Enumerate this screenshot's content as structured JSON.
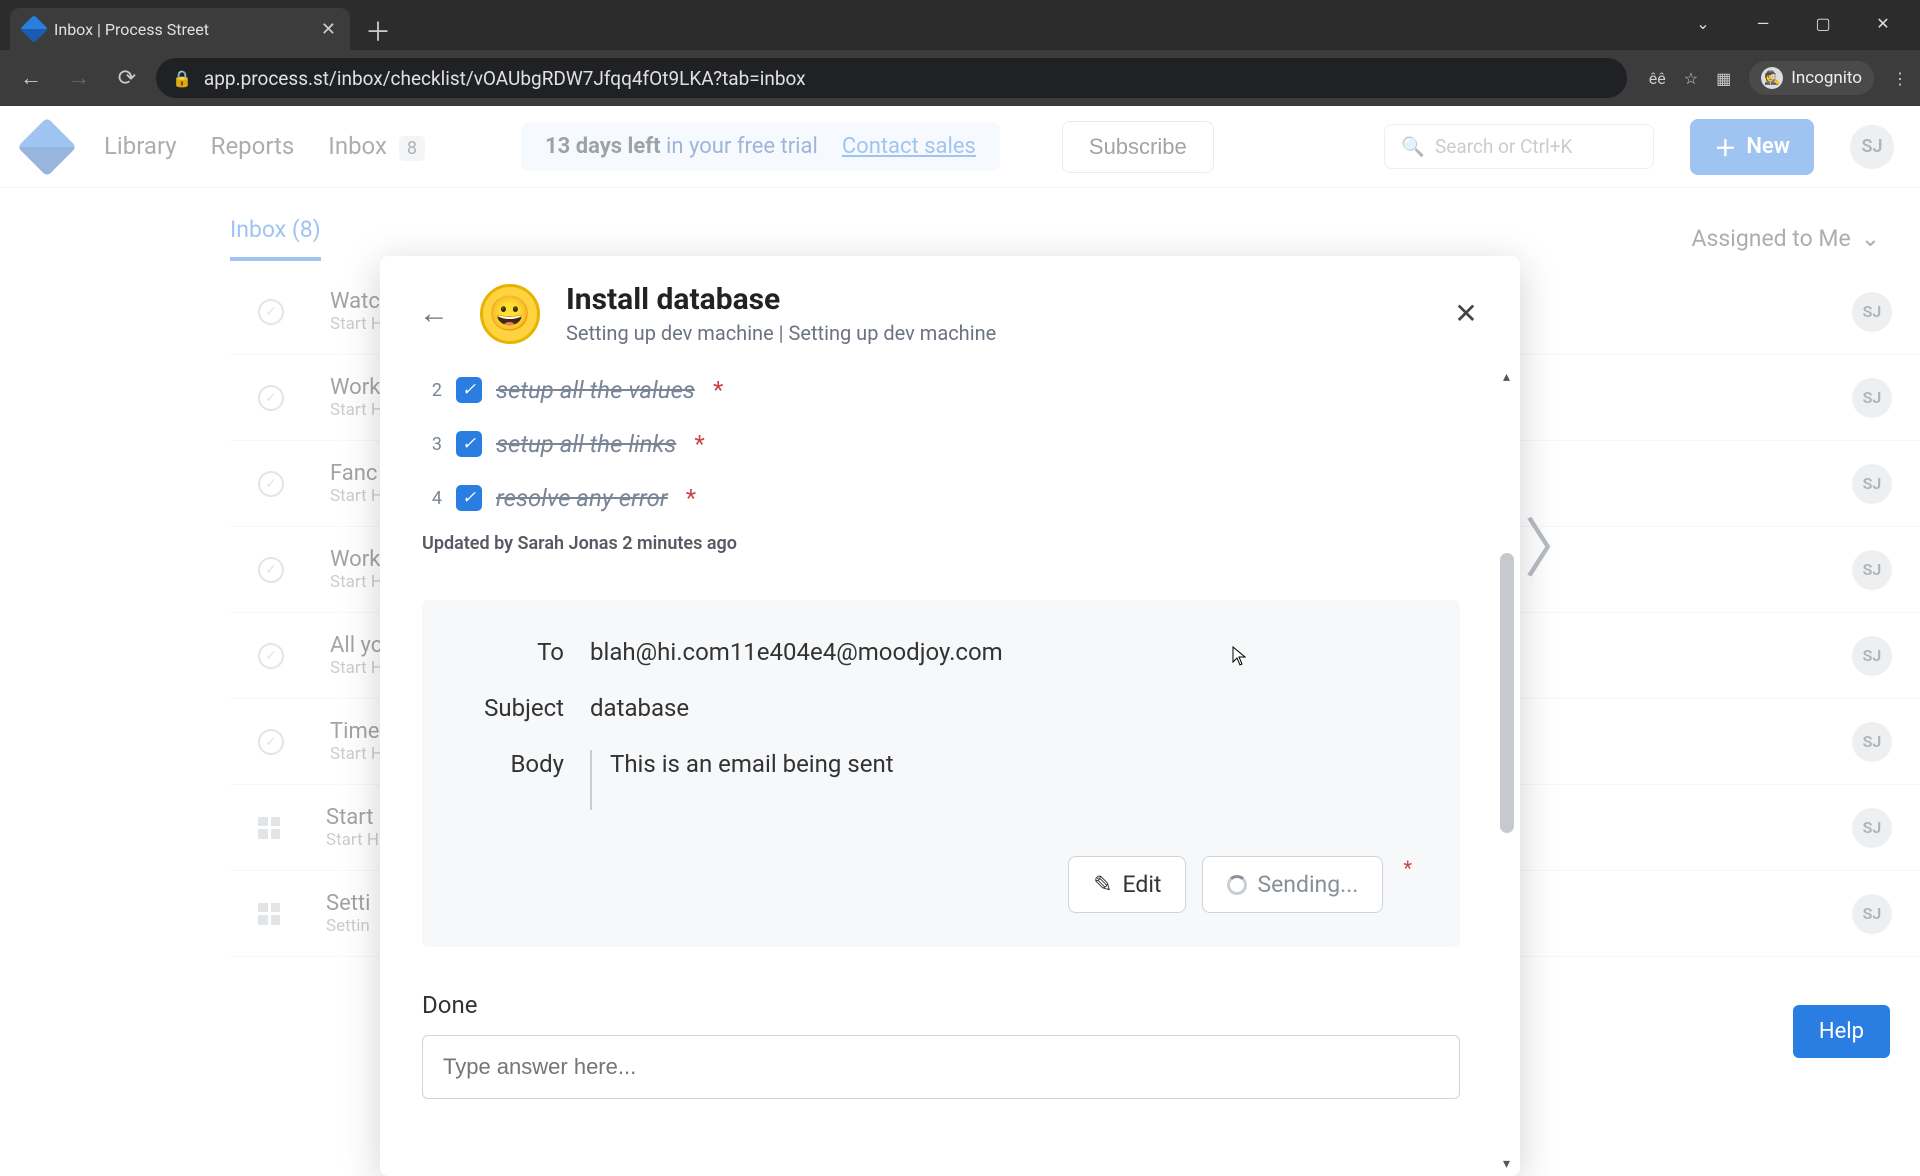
{
  "browser": {
    "tab_title": "Inbox | Process Street",
    "url": "app.process.st/inbox/checklist/vOAUbgRDW7Jfqq4fOt9LKA?tab=inbox",
    "incognito_label": "Incognito"
  },
  "header": {
    "nav": {
      "library": "Library",
      "reports": "Reports",
      "inbox": "Inbox",
      "inbox_count": "8"
    },
    "trial_days": "13 days left",
    "trial_tail": " in your free trial   ",
    "contact_sales": "Contact sales",
    "subscribe": "Subscribe",
    "search_placeholder": "Search or Ctrl+K",
    "new_label": "New",
    "avatar_initials": "SJ"
  },
  "inbox": {
    "tab_label": "Inbox (8)",
    "assigned_label": "Assigned to Me",
    "rows": [
      {
        "title": "Watc",
        "sub": "Start H",
        "icon": "circle"
      },
      {
        "title": "Work",
        "sub": "Start H",
        "icon": "circle"
      },
      {
        "title": "Fanc",
        "sub": "Start H",
        "icon": "circle"
      },
      {
        "title": "Work",
        "sub": "Start H",
        "icon": "circle"
      },
      {
        "title": "All yo",
        "sub": "Start H",
        "icon": "circle"
      },
      {
        "title": "Time",
        "sub": "Start H",
        "icon": "circle"
      },
      {
        "title": "Start",
        "sub": "Start H",
        "icon": "grid"
      },
      {
        "title": "Setti",
        "sub": "Settin",
        "icon": "grid"
      }
    ],
    "row_avatar": "SJ"
  },
  "modal": {
    "title": "Install database",
    "subtitle": "Setting up dev machine | Setting up dev machine",
    "checks": [
      {
        "n": "2",
        "label": "setup all the values"
      },
      {
        "n": "3",
        "label": "setup all the links"
      },
      {
        "n": "4",
        "label": "resolve any error"
      }
    ],
    "updated": "Updated by Sarah Jonas 2 minutes ago",
    "email": {
      "to_label": "To",
      "to_value": "blah@hi.com11e404e4@moodjoy.com",
      "subject_label": "Subject",
      "subject_value": "database",
      "body_label": "Body",
      "body_value": "This is an email being sent",
      "edit_label": "Edit",
      "sending_label": "Sending..."
    },
    "done_label": "Done",
    "answer_placeholder": "Type answer here..."
  },
  "help_label": "Help"
}
